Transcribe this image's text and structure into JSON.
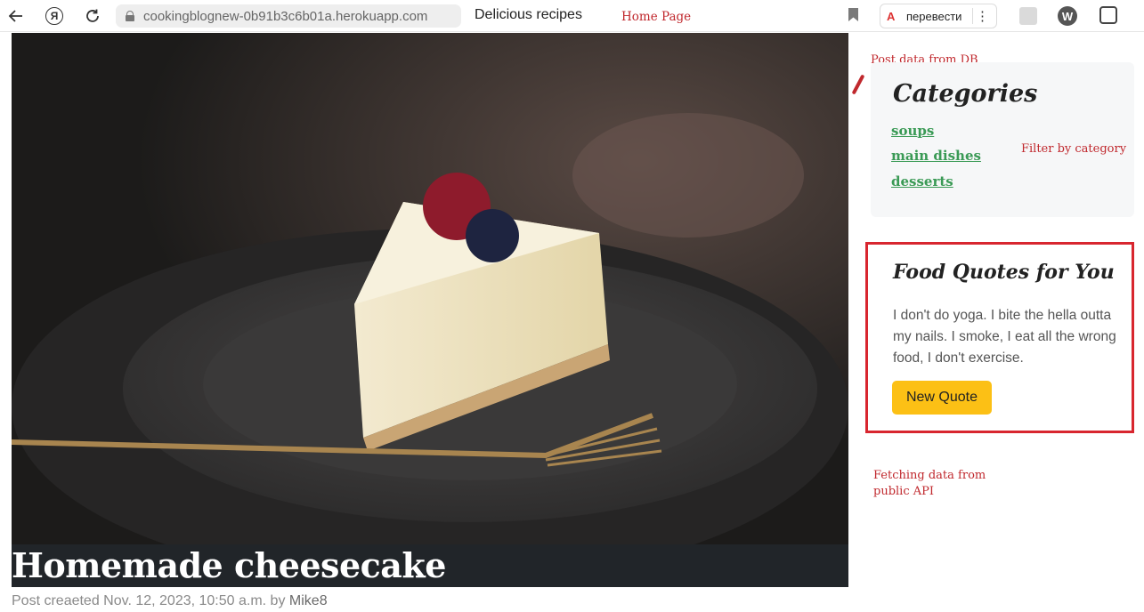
{
  "browser": {
    "url": "cookingblognew-0b91b3c6b01a.herokuapp.com",
    "tab_title": "Delicious recipes",
    "translate_label": "перевести",
    "extension_letter": "W",
    "yandex_letter": "Я",
    "translate_icon_text": "A"
  },
  "annotations": {
    "home_page": "Home Page",
    "post_data": "Post data from DB",
    "filter": "Filter by category",
    "fetching_line1": "Fetching data from",
    "fetching_line2": "public API",
    "color": "#c0282d"
  },
  "post": {
    "title": "Homemade cheesecake",
    "meta_prefix": "Post creaeted Nov. 12, 2023, 10:50 a.m. by",
    "author": "Mike8"
  },
  "categories": {
    "heading": "Categories",
    "items": [
      "soups",
      "main dishes",
      "desserts"
    ],
    "link_color": "#3a9a55"
  },
  "quotes": {
    "heading": "Food Quotes for You",
    "text": "I don't do yoga. I bite the hella outta my nails. I smoke, I eat all the wrong food, I don't exercise.",
    "button_label": "New Quote",
    "button_color": "#fcc015",
    "border_color": "#d8262f"
  },
  "icons": {
    "back": "arrow-left-icon",
    "reload": "reload-icon",
    "lock": "lock-icon",
    "bookmark": "bookmark-icon",
    "menu": "more-vertical-icon"
  }
}
